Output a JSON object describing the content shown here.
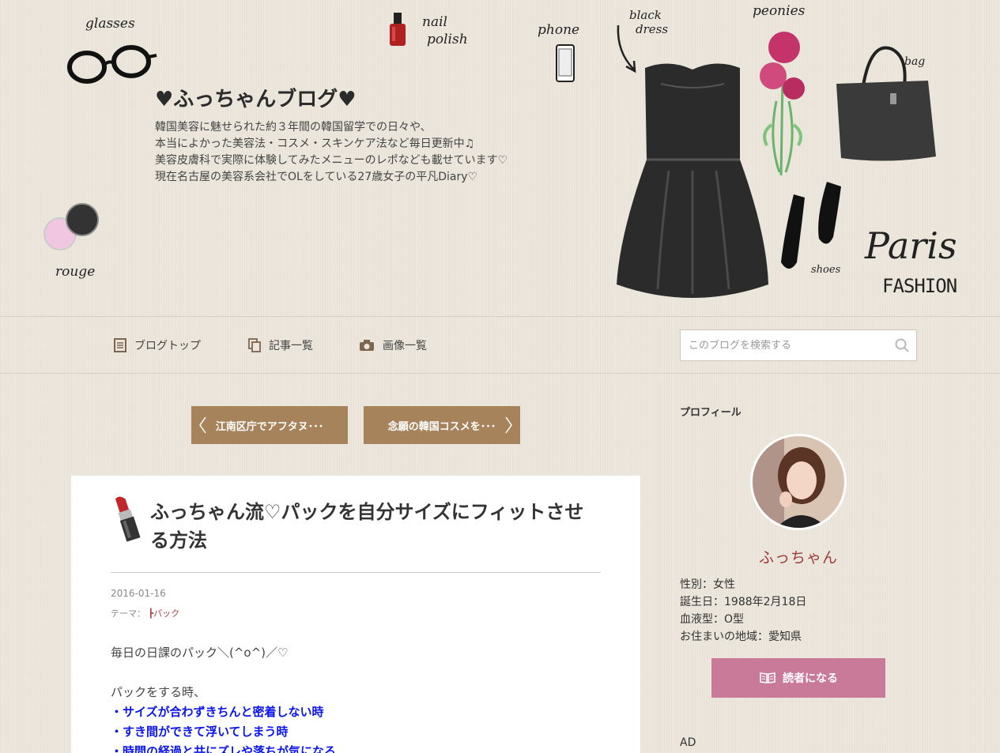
{
  "header": {
    "title": "♥ふっちゃんブログ♥",
    "description": [
      "韓国美容に魅せられた約３年間の韓国留学での日々や、",
      "本当によかった美容法・コスメ・スキンケア法など毎日更新中♫",
      "美容皮膚科で実際に体験してみたメニューのレポなども載せています♡",
      "現在名古屋の美容系会社でOLをしている27歳女子の平凡Diary♡"
    ],
    "deco": {
      "glasses": "glasses",
      "nail": "nail",
      "polish": "polish",
      "phone": "phone",
      "black": "black",
      "dress": "dress",
      "peonies": "peonies",
      "bag": "bag",
      "rouge": "rouge",
      "shoes": "shoes",
      "paris": "Paris",
      "fashion": "FASHION"
    }
  },
  "nav": {
    "items": [
      {
        "label": "ブログトップ",
        "icon": "document-icon"
      },
      {
        "label": "記事一覧",
        "icon": "copy-icon"
      },
      {
        "label": "画像一覧",
        "icon": "camera-icon"
      }
    ],
    "search_placeholder": "このブログを検索する"
  },
  "pager": {
    "prev": "江南区庁でアフタヌ･･･",
    "next": "念願の韓国コスメを･･･"
  },
  "article": {
    "title": "ふっちゃん流♡パックを自分サイズにフィットさせる方法",
    "date": "2016-01-16",
    "theme_label": "テーマ：",
    "theme_value": "パック",
    "intro": "毎日の日課のパック＼(^o^)／♡",
    "lead": "パックをする時、",
    "points": [
      "・サイズが合わずきちんと密着しない時",
      "・すき間ができて浮いてしまう時",
      "・時間の経過と共にズレや落ちが気になる"
    ]
  },
  "sidebar": {
    "heading": "プロフィール",
    "name": "ふっちゃん",
    "info": [
      "性別：女性",
      "誕生日：1988年2月18日",
      "血液型：O型",
      "お住まいの地域：愛知県"
    ],
    "follow_label": "読者になる",
    "ad_label": "AD"
  },
  "colors": {
    "accent_brown": "#a7835c",
    "follow_pink": "#c97a98",
    "name_red": "#9c3a3a",
    "link_blue": "#0b15ee"
  }
}
